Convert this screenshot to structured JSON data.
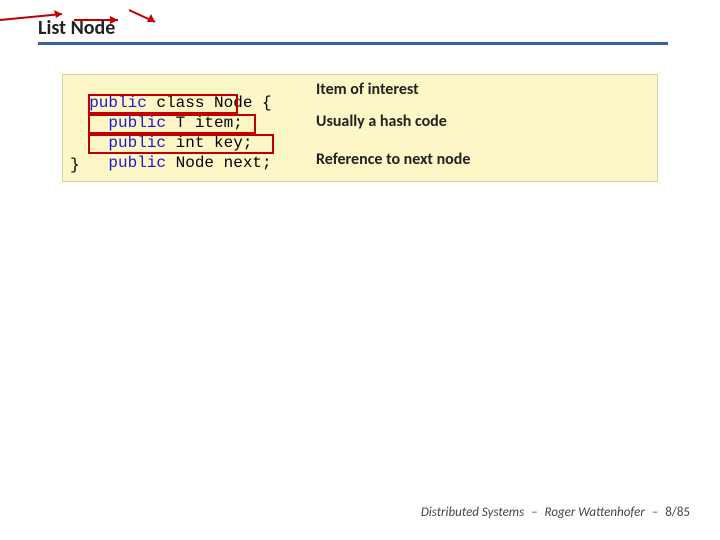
{
  "title": "List Node",
  "code": {
    "line1_kw": "public",
    "line1_rest": " class Node {",
    "line2_kw": "public",
    "line2_rest": " T item;",
    "line3_kw": "public",
    "line3_rest": " int key;",
    "line4_kw": "public",
    "line4_rest": " Node next;",
    "line5": "}"
  },
  "annotations": {
    "a1": "Item of interest",
    "a2": "Usually a hash code",
    "a3": "Reference to next node"
  },
  "footer": {
    "course": "Distributed Systems",
    "author": "Roger Wattenhofer",
    "page": "8/85",
    "sep": "–"
  }
}
